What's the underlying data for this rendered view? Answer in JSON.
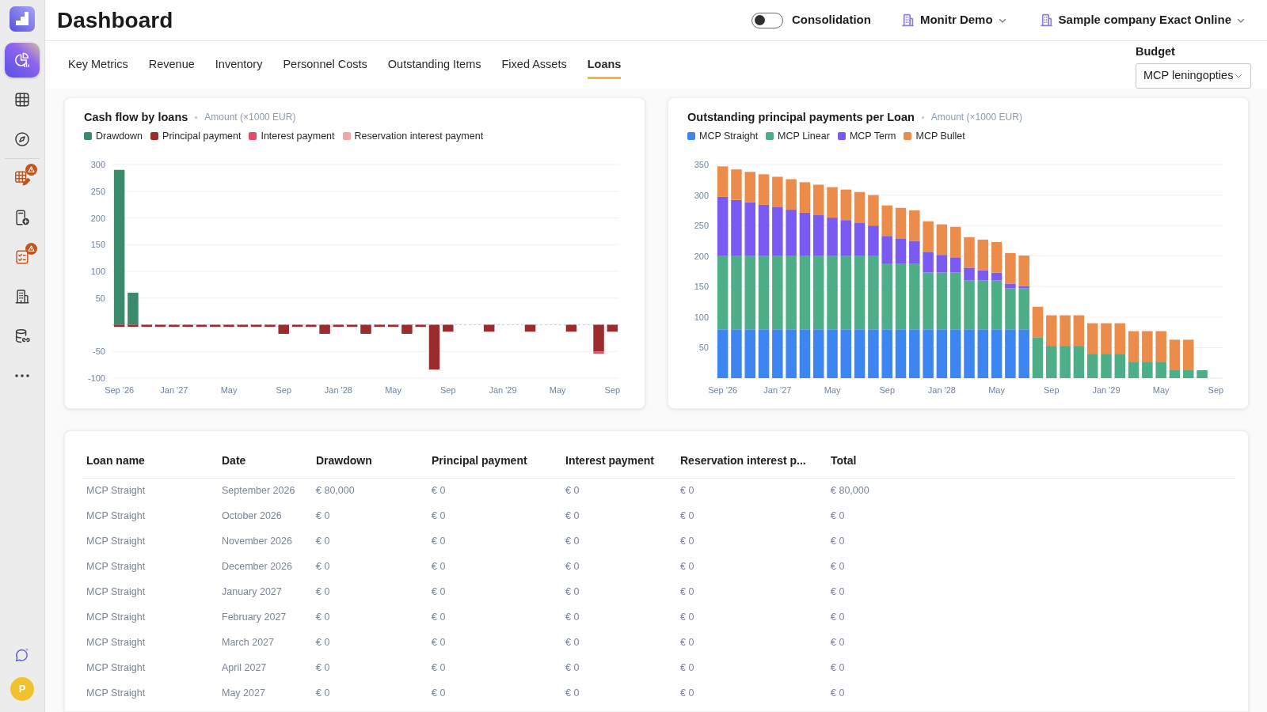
{
  "sidebar": {
    "sections": [
      {
        "items": [
          {
            "selected": true,
            "warning": false
          },
          {
            "selected": false,
            "warning": false
          },
          {
            "selected": false,
            "warning": false
          }
        ]
      },
      {
        "items": [
          {
            "selected": false,
            "warning": true
          },
          {
            "selected": false,
            "warning": false
          },
          {
            "selected": false,
            "warning": true
          },
          {
            "selected": false,
            "warning": false
          },
          {
            "selected": false,
            "warning": false
          },
          {
            "selected": false,
            "warning": false
          }
        ]
      }
    ],
    "avatar": "P"
  },
  "header": {
    "title": "Dashboard",
    "consolidation": {
      "label": "Consolidation",
      "on": false
    },
    "selectors": [
      {
        "label": "Monitr Demo"
      },
      {
        "label": "Sample company Exact Online"
      }
    ]
  },
  "tabs": [
    {
      "label": "Key Metrics",
      "selected": false
    },
    {
      "label": "Revenue",
      "selected": false
    },
    {
      "label": "Inventory",
      "selected": false
    },
    {
      "label": "Personnel Costs",
      "selected": false
    },
    {
      "label": "Outstanding Items",
      "selected": false
    },
    {
      "label": "Fixed Assets",
      "selected": false
    },
    {
      "label": "Loans",
      "selected": true
    }
  ],
  "budget": {
    "label": "Budget",
    "value": "MCP leningopties"
  },
  "charts": [
    {
      "unit": "Amount (×1000 EUR)",
      "chart_data": {
        "type": "bar",
        "title": "Cash flow by loans",
        "stacked": true,
        "grid": true,
        "categories": [
          "Sep '26",
          null,
          null,
          null,
          "Jan '27",
          null,
          null,
          null,
          "May",
          null,
          null,
          null,
          "Sep",
          null,
          null,
          null,
          "Jan '28",
          null,
          null,
          null,
          "May",
          null,
          null,
          null,
          "Sep",
          null,
          null,
          null,
          "Jan '29",
          null,
          null,
          null,
          "May",
          null,
          null,
          null,
          "Sep"
        ],
        "ylim": [
          -100,
          300
        ],
        "yticks": [
          -100,
          -50,
          50,
          100,
          150,
          200,
          250,
          300
        ],
        "ref_lines": [
          {
            "axis": "y",
            "value": 0
          }
        ],
        "series": [
          {
            "name": "Drawdown",
            "color": "#3a8a6c",
            "values": [
              290,
              60,
              null,
              null,
              null,
              null,
              null,
              null,
              null,
              null,
              null,
              null,
              null,
              null,
              null,
              null,
              null,
              null,
              null,
              null,
              null,
              null,
              null,
              null,
              null,
              null,
              null,
              null,
              null,
              null,
              null,
              null,
              null,
              null,
              null,
              null,
              null
            ]
          },
          {
            "name": "Principal payment",
            "color": "#9c2b2e",
            "values": [
              -4,
              -4,
              -4,
              -4,
              -4,
              -4,
              -4,
              -4,
              -4,
              -4,
              -4,
              -4,
              -17,
              -4,
              -4,
              -17,
              -4,
              -4,
              -17,
              -4,
              -4,
              -17,
              -4,
              -84,
              -13,
              null,
              null,
              -13,
              null,
              null,
              -13,
              null,
              null,
              -13,
              null,
              -50,
              -13
            ]
          },
          {
            "name": "Interest payment",
            "color": "#e0506a",
            "values": [
              null,
              null,
              null,
              null,
              null,
              null,
              null,
              null,
              null,
              null,
              null,
              null,
              null,
              null,
              null,
              null,
              null,
              null,
              null,
              null,
              null,
              null,
              null,
              null,
              null,
              null,
              null,
              null,
              null,
              null,
              null,
              null,
              null,
              null,
              null,
              -4,
              null
            ]
          },
          {
            "name": "Reservation interest payment",
            "color": "#f2a7a7",
            "values": [
              null,
              null,
              null,
              null,
              null,
              null,
              null,
              null,
              null,
              null,
              null,
              null,
              null,
              null,
              null,
              null,
              null,
              null,
              null,
              null,
              null,
              null,
              null,
              null,
              null,
              null,
              null,
              null,
              null,
              null,
              null,
              null,
              null,
              null,
              null,
              null,
              null
            ]
          }
        ]
      }
    },
    {
      "unit": "Amount (×1000 EUR)",
      "chart_data": {
        "type": "bar",
        "title": "Outstanding principal payments per Loan",
        "stacked": true,
        "grid": true,
        "categories": [
          "Sep '26",
          null,
          null,
          null,
          "Jan '27",
          null,
          null,
          null,
          "May",
          null,
          null,
          null,
          "Sep",
          null,
          null,
          null,
          "Jan '28",
          null,
          null,
          null,
          "May",
          null,
          null,
          null,
          "Sep",
          null,
          null,
          null,
          "Jan '29",
          null,
          null,
          null,
          "May",
          null,
          null,
          null,
          "Sep"
        ],
        "ylim": [
          0,
          350
        ],
        "yticks": [
          50,
          100,
          150,
          200,
          250,
          300,
          350
        ],
        "series": [
          {
            "name": "MCP Straight",
            "color": "#3d85f0",
            "values": [
              80,
              80,
              80,
              80,
              80,
              80,
              80,
              80,
              80,
              80,
              80,
              80,
              80,
              80,
              80,
              80,
              80,
              80,
              80,
              80,
              80,
              80,
              80,
              0,
              0,
              0,
              0,
              0,
              0,
              0,
              0,
              0,
              0,
              0,
              0,
              0,
              0
            ]
          },
          {
            "name": "MCP Linear",
            "color": "#4eae88",
            "values": [
              120,
              120,
              120,
              120,
              120,
              120,
              120,
              120,
              120,
              120,
              120,
              120,
              107,
              107,
              107,
              93,
              93,
              93,
              80,
              80,
              80,
              67,
              67,
              67,
              53,
              53,
              53,
              40,
              40,
              40,
              27,
              27,
              27,
              13,
              13,
              13,
              0
            ]
          },
          {
            "name": "MCP Term",
            "color": "#7a5af0",
            "values": [
              97,
              92,
              88,
              84,
              80,
              76,
              71,
              67,
              63,
              59,
              55,
              50,
              46,
              42,
              38,
              34,
              29,
              25,
              21,
              17,
              13,
              8,
              4,
              0,
              0,
              0,
              0,
              0,
              0,
              0,
              0,
              0,
              0,
              0,
              0,
              0,
              0
            ]
          },
          {
            "name": "MCP Bullet",
            "color": "#ec8c4b",
            "values": [
              50,
              50,
              50,
              50,
              50,
              50,
              50,
              50,
              50,
              50,
              50,
              50,
              50,
              50,
              50,
              50,
              50,
              50,
              50,
              50,
              50,
              50,
              50,
              50,
              50,
              50,
              50,
              50,
              50,
              50,
              50,
              50,
              50,
              50,
              50,
              0,
              0
            ]
          }
        ]
      }
    }
  ],
  "table": {
    "columns": [
      "Loan name",
      "Date",
      "Drawdown",
      "Principal payment",
      "Interest payment",
      "Reservation interest p...",
      "Total"
    ],
    "rows": [
      [
        "MCP Straight",
        "September 2026",
        "€ 80,000",
        "€ 0",
        "€ 0",
        "€ 0",
        "€ 80,000"
      ],
      [
        "MCP Straight",
        "October 2026",
        "€ 0",
        "€ 0",
        "€ 0",
        "€ 0",
        "€ 0"
      ],
      [
        "MCP Straight",
        "November 2026",
        "€ 0",
        "€ 0",
        "€ 0",
        "€ 0",
        "€ 0"
      ],
      [
        "MCP Straight",
        "December 2026",
        "€ 0",
        "€ 0",
        "€ 0",
        "€ 0",
        "€ 0"
      ],
      [
        "MCP Straight",
        "January 2027",
        "€ 0",
        "€ 0",
        "€ 0",
        "€ 0",
        "€ 0"
      ],
      [
        "MCP Straight",
        "February 2027",
        "€ 0",
        "€ 0",
        "€ 0",
        "€ 0",
        "€ 0"
      ],
      [
        "MCP Straight",
        "March 2027",
        "€ 0",
        "€ 0",
        "€ 0",
        "€ 0",
        "€ 0"
      ],
      [
        "MCP Straight",
        "April 2027",
        "€ 0",
        "€ 0",
        "€ 0",
        "€ 0",
        "€ 0"
      ],
      [
        "MCP Straight",
        "May 2027",
        "€ 0",
        "€ 0",
        "€ 0",
        "€ 0",
        "€ 0"
      ]
    ]
  }
}
